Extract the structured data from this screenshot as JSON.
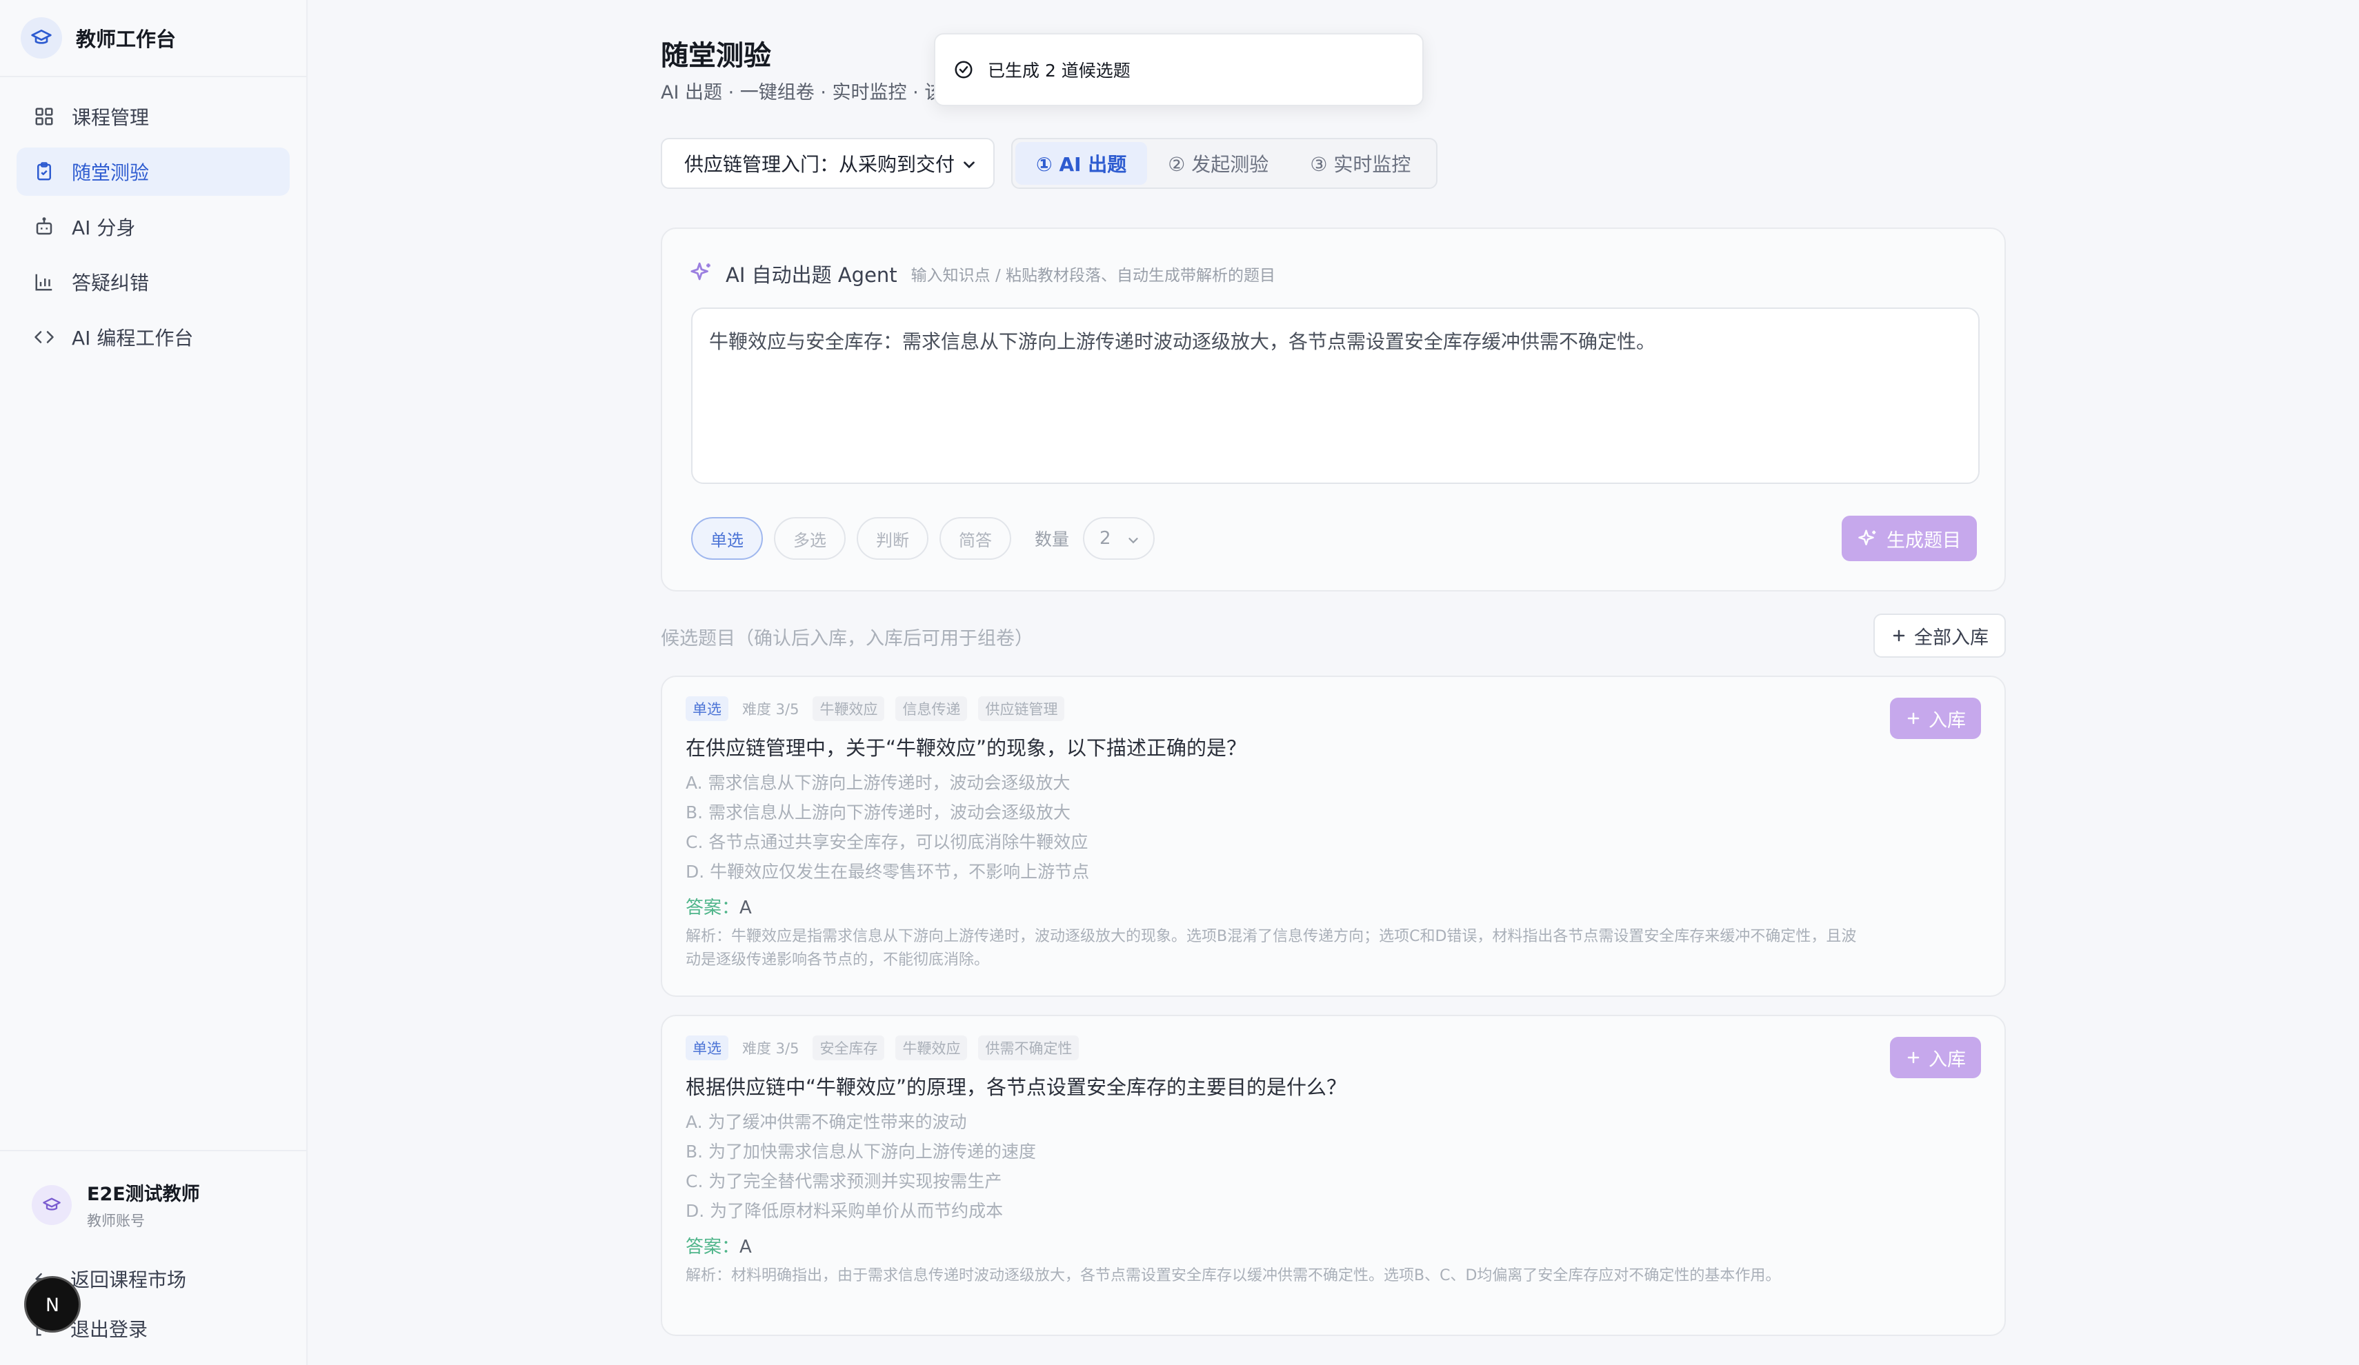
{
  "app": {
    "brand_name": "教师工作台"
  },
  "sidebar": {
    "items": [
      {
        "label": "课程管理",
        "icon": "grid-icon"
      },
      {
        "label": "随堂测验",
        "icon": "clipboard-icon"
      },
      {
        "label": "AI 分身",
        "icon": "robot-icon"
      },
      {
        "label": "答疑纠错",
        "icon": "bar-chart-icon"
      },
      {
        "label": "AI 编程工作台",
        "icon": "code-icon"
      }
    ],
    "active_index": 1,
    "user": {
      "name": "E2E测试教师",
      "role": "教师账号"
    },
    "back_label": "返回课程市场",
    "logout_label": "退出登录",
    "n_badge": "N"
  },
  "page": {
    "title": "随堂测验",
    "subtitle": "AI 出题 · 一键组卷 · 实时监控 · 该"
  },
  "toast": {
    "text": "已生成 2 道候选题"
  },
  "course_select": {
    "value": "供应链管理入门：从采购到交付"
  },
  "steps": [
    {
      "label": "① AI 出题",
      "active": true
    },
    {
      "label": "② 发起测验",
      "active": false
    },
    {
      "label": "③ 实时监控",
      "active": false
    }
  ],
  "agent": {
    "title": "AI 自动出题 Agent",
    "hint": "输入知识点 / 粘贴教材段落、自动生成带解析的题目",
    "input_value": "牛鞭效应与安全库存：需求信息从下游向上游传递时波动逐级放大，各节点需设置安全库存缓冲供需不确定性。",
    "types": [
      {
        "label": "单选",
        "active": true
      },
      {
        "label": "多选",
        "active": false
      },
      {
        "label": "判断",
        "active": false
      },
      {
        "label": "简答",
        "active": false
      }
    ],
    "quantity_label": "数量",
    "quantity_value": "2",
    "generate_label": "生成题目"
  },
  "candidates": {
    "label": "候选题目（确认后入库，入库后可用于组卷）",
    "add_all_label": "全部入库",
    "add_label": "入库",
    "answer_label": "答案：",
    "questions": [
      {
        "type": "单选",
        "difficulty": "难度 3/5",
        "tags": [
          "牛鞭效应",
          "信息传递",
          "供应链管理"
        ],
        "title": "在供应链管理中，关于“牛鞭效应”的现象，以下描述正确的是？",
        "options": [
          "A. 需求信息从下游向上游传递时，波动会逐级放大",
          "B. 需求信息从上游向下游传递时，波动会逐级放大",
          "C. 各节点通过共享安全库存，可以彻底消除牛鞭效应",
          "D. 牛鞭效应仅发生在最终零售环节，不影响上游节点"
        ],
        "answer": "A",
        "explanation": "解析：牛鞭效应是指需求信息从下游向上游传递时，波动逐级放大的现象。选项B混淆了信息传递方向；选项C和D错误，材料指出各节点需设置安全库存来缓冲不确定性，且波动是逐级传递影响各节点的，不能彻底消除。"
      },
      {
        "type": "单选",
        "difficulty": "难度 3/5",
        "tags": [
          "安全库存",
          "牛鞭效应",
          "供需不确定性"
        ],
        "title": "根据供应链中“牛鞭效应”的原理，各节点设置安全库存的主要目的是什么？",
        "options": [
          "A. 为了缓冲供需不确定性带来的波动",
          "B. 为了加快需求信息从下游向上游传递的速度",
          "C. 为了完全替代需求预测并实现按需生产",
          "D. 为了降低原材料采购单价从而节约成本"
        ],
        "answer": "A",
        "explanation": "解析：材料明确指出，由于需求信息传递时波动逐级放大，各节点需设置安全库存以缓冲供需不确定性。选项B、C、D均偏离了安全库存应对不确定性的基本作用。"
      }
    ]
  }
}
